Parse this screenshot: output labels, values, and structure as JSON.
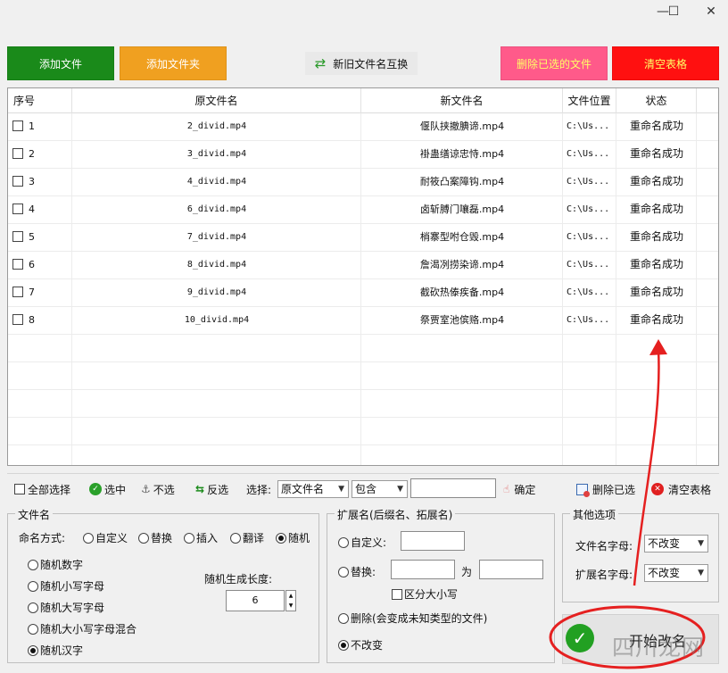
{
  "window": {
    "minimize": "—",
    "maximize": "☐",
    "close": "✕"
  },
  "top_buttons": {
    "add_file": "添加文件",
    "add_folder": "添加文件夹",
    "swap_names": "新旧文件名互换",
    "delete_selected": "删除已选的文件",
    "clear_table": "清空表格"
  },
  "colors": {
    "add_file": "#1a8a1a",
    "add_folder": "#f0a020",
    "delete_selected": "#ff5a8a",
    "clear_table": "#ff1010",
    "delete_text": "#ffff66"
  },
  "table": {
    "headers": [
      "序号",
      "原文件名",
      "新文件名",
      "文件位置",
      "状态"
    ],
    "rows": [
      {
        "no": "1",
        "original": "2_divid.mp4",
        "new": "偃队挟撤腆谛.mp4",
        "location": "C:\\Us...",
        "status": "重命名成功"
      },
      {
        "no": "2",
        "original": "3_divid.mp4",
        "new": "褂蛊缮谅忠恃.mp4",
        "location": "C:\\Us...",
        "status": "重命名成功"
      },
      {
        "no": "3",
        "original": "4_divid.mp4",
        "new": "耐筱凸案障钩.mp4",
        "location": "C:\\Us...",
        "status": "重命名成功"
      },
      {
        "no": "4",
        "original": "6_divid.mp4",
        "new": "卤斩膊门嚷磊.mp4",
        "location": "C:\\Us...",
        "status": "重命名成功"
      },
      {
        "no": "5",
        "original": "7_divid.mp4",
        "new": "梢寨型咐仓毁.mp4",
        "location": "C:\\Us...",
        "status": "重命名成功"
      },
      {
        "no": "6",
        "original": "8_divid.mp4",
        "new": "詹渴冽捞染谛.mp4",
        "location": "C:\\Us...",
        "status": "重命名成功"
      },
      {
        "no": "7",
        "original": "9_divid.mp4",
        "new": "截砍热傣疾备.mp4",
        "location": "C:\\Us...",
        "status": "重命名成功"
      },
      {
        "no": "8",
        "original": "10_divid.mp4",
        "new": "祭贾室池傧赂.mp4",
        "location": "C:\\Us...",
        "status": "重命名成功"
      }
    ]
  },
  "toolbar": {
    "select_all": "全部选择",
    "select": "选中",
    "deselect": "不选",
    "invert": "反选",
    "choose_label": "选择:",
    "field_value": "原文件名",
    "match_value": "包含",
    "filter_value": "",
    "confirm": "确定",
    "delete_selected": "删除已选",
    "clear_table": "清空表格"
  },
  "filename_group": {
    "title": "文件名",
    "mode_label": "命名方式:",
    "modes": [
      "自定义",
      "替换",
      "插入",
      "翻译",
      "随机"
    ],
    "random_options": [
      "随机数字",
      "随机小写字母",
      "随机大写字母",
      "随机大小写字母混合",
      "随机汉字"
    ],
    "length_label": "随机生成长度:",
    "length_value": "6"
  },
  "ext_group": {
    "title": "扩展名(后缀名、拓展名)",
    "custom": "自定义:",
    "replace": "替换:",
    "to": "为",
    "case_sensitive": "区分大小写",
    "delete": "删除(会变成未知类型的文件)",
    "no_change": "不改变"
  },
  "other_group": {
    "title": "其他选项",
    "filename_case_label": "文件名字母:",
    "filename_case_value": "不改变",
    "ext_case_label": "扩展名字母:",
    "ext_case_value": "不改变"
  },
  "start_button": {
    "label": "开始改名"
  },
  "watermark": "四川龙网"
}
